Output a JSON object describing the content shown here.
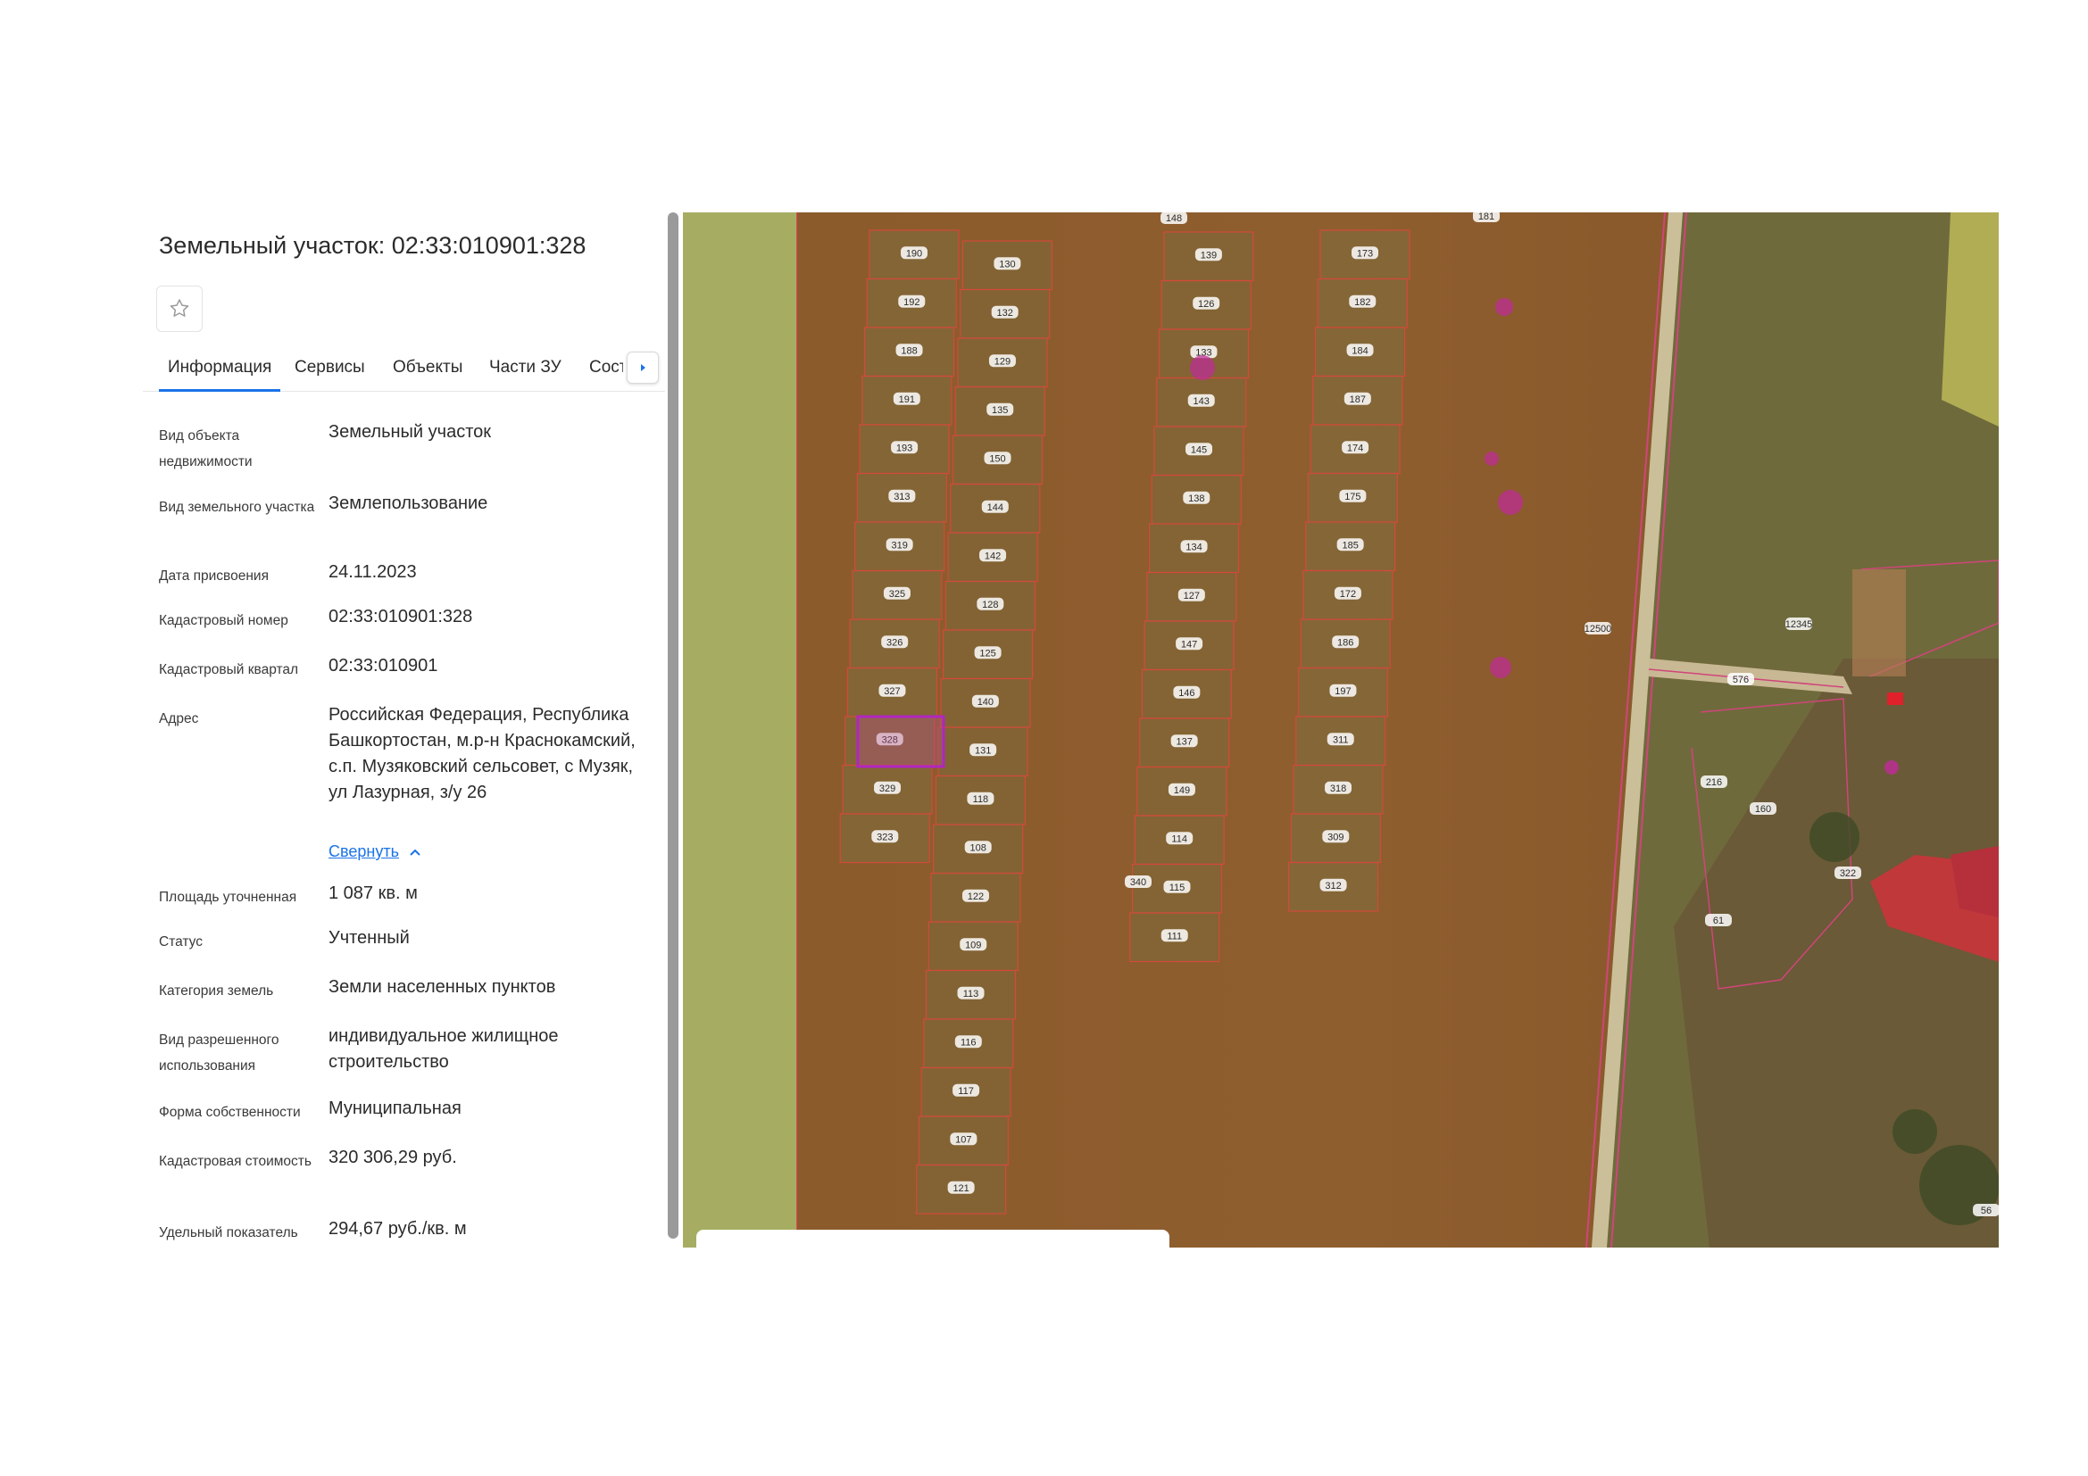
{
  "panel": {
    "title": "Земельный участок: 02:33:010901:328",
    "tabs": [
      "Информация",
      "Сервисы",
      "Объекты",
      "Части ЗУ",
      "Соста"
    ],
    "rows": [
      {
        "label": "Вид объекта недвижимости",
        "value": "Земельный участок"
      },
      {
        "label": "Вид земельного участка",
        "value": "Землепользование"
      },
      {
        "label": "Дата присвоения",
        "value": "24.11.2023"
      },
      {
        "label": "Кадастровый номер",
        "value": "02:33:010901:328"
      },
      {
        "label": "Кадастровый квартал",
        "value": "02:33:010901"
      },
      {
        "label": "Адрес",
        "value": "Российская Федерация, Республика Башкортостан, м.р-н Краснокамский, с.п. Музяковский сельсовет, с Музяк, ул Лазурная, з/у 26"
      },
      {
        "label": "Площадь уточненная",
        "value": "1 087 кв. м"
      },
      {
        "label": "Статус",
        "value": "Учтенный"
      },
      {
        "label": "Категория земель",
        "value": "Земли населенных пунктов"
      },
      {
        "label": "Вид разрешенного использования",
        "value": "индивидуальное жилищное строительство"
      },
      {
        "label": "Форма собственности",
        "value": "Муниципальная"
      },
      {
        "label": "Кадастровая стоимость",
        "value": "320 306,29 руб."
      },
      {
        "label": "Удельный показатель",
        "value": "294,67 руб./кв. м"
      }
    ],
    "collapse_label": "Свернуть"
  },
  "map": {
    "columns": [
      [
        "190",
        "192",
        "188",
        "191",
        "193",
        "313",
        "319",
        "325",
        "326",
        "327",
        "328",
        "329",
        "323"
      ],
      [
        "130",
        "132",
        "129",
        "135",
        "150",
        "144",
        "142",
        "128",
        "125",
        "140",
        "131",
        "118",
        "108",
        "122",
        "109",
        "113",
        "116",
        "117",
        "107",
        "121"
      ],
      [
        "139",
        "126",
        "133",
        "143",
        "145",
        "138",
        "134",
        "127",
        "147",
        "146",
        "137",
        "149",
        "114",
        "115",
        "111"
      ],
      [
        "173",
        "182",
        "184",
        "187",
        "174",
        "175",
        "185",
        "172",
        "186",
        "197",
        "311",
        "318",
        "309",
        "312"
      ]
    ],
    "partial_labels": [
      "148",
      "181"
    ],
    "extra_labels": [
      "340",
      "216",
      "160",
      "322",
      "61",
      "56"
    ],
    "road_labels": [
      "12500",
      "576",
      "12345"
    ],
    "selected_plot": "328"
  }
}
